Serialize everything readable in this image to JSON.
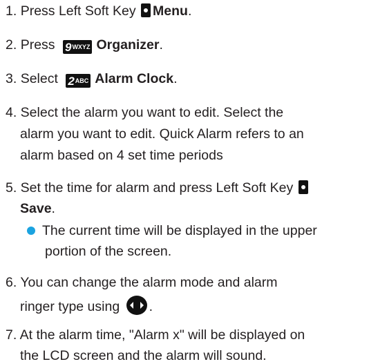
{
  "steps": {
    "s1": {
      "number": "1.",
      "text": "Press Left Soft Key",
      "action": "Menu",
      "period": "."
    },
    "s2": {
      "number": "2.",
      "text": "Press",
      "key_digit": "9",
      "key_letters": "WXYZ",
      "action": "Organizer",
      "period": "."
    },
    "s3": {
      "number": "3.",
      "text": "Select",
      "key_digit": "2",
      "key_letters": "ABC",
      "action": "Alarm Clock",
      "period": "."
    },
    "s4": {
      "line1": "4. Select the alarm you want to edit. Select the",
      "line2": "alarm you want to edit.  Quick Alarm refers to an",
      "line3": "alarm based on 4 set time periods"
    },
    "s5": {
      "line1": "5. Set the time for alarm and press Left Soft Key",
      "action": "Save",
      "period": "."
    },
    "note": {
      "line1": "The current time will be displayed in the upper",
      "line2": "portion of the screen."
    },
    "s6": {
      "line1": "6. You can change the alarm mode and alarm",
      "line2": "ringer type using",
      "period": "."
    },
    "s7": {
      "line1": "7. At the alarm time, \"Alarm x\" will be displayed on",
      "line2": "the LCD screen and the alarm will sound."
    }
  },
  "icons": {
    "soft_key": "left-soft-key-icon",
    "nav_key": "navigation-key-icon",
    "bullet_color": "#1ba3e0"
  }
}
